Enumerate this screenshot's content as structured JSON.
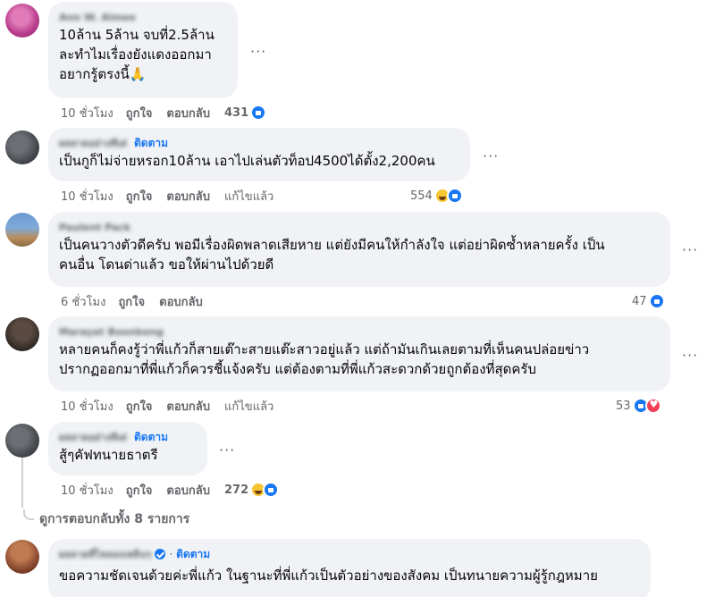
{
  "comments": [
    {
      "name": "Ann W. Aimee",
      "follow": "",
      "text": [
        "10ล้าน 5ล้าน จบที่2.5ล้าน",
        "ละทำไมเรื่องยังแดงออกมา",
        "อยากรู้ตรงนี้🙏"
      ],
      "time": "10 ชั่วโมง",
      "like": "ถูกใจ",
      "reply": "ตอบกลับ",
      "edited": "",
      "count": "431",
      "reactions": [
        "like"
      ]
    },
    {
      "name": "ผลลาดอย่างทีเด่",
      "follow": "ติดตาม",
      "text": [
        "เป็นกูก็ไม่จ่ายหรอก10ล้าน เอาไปเล่นตัวท็อป4500ได้ตั้ง2,200คน"
      ],
      "time": "10 ชั่วโมง",
      "like": "ถูกใจ",
      "reply": "ตอบกลับ",
      "edited": "แก้ไขแล้ว",
      "count": "554",
      "reactions": [
        "haha",
        "like"
      ]
    },
    {
      "name": "Paulent Pack",
      "follow": "",
      "text": [
        "เป็นคนวางตัวดีครับ พอมีเรื่องผิดพลาดเสียหาย แต่ยังมีคนให้กำลังใจ แต่อย่าผิดซ้ำหลายครั้ง เป็น",
        "คนอื่น โดนด่าแล้ว ขอให้ผ่านไปด้วยดี"
      ],
      "time": "6 ชั่วโมง",
      "like": "ถูกใจ",
      "reply": "ตอบกลับ",
      "edited": "",
      "count": "47",
      "reactions": [
        "like"
      ]
    },
    {
      "name": "Marayat Boonbong",
      "follow": "",
      "text": [
        "หลายคนก็คงรู้ว่าพี่แก้วก็สายเต๊าะสายแต๊ะสาวอยู่แล้ว แต่ถ้ามันเกินเลยตามที่เห็นคนปล่อยข่าว",
        "ปรากฏออกมาที่พี่แก้วก็ควรชี้แจ้งครับ แต่ต้องตามที่พี่แก้วสะดวกด้วยถูกต้องที่สุดครับ"
      ],
      "time": "10 ชั่วโมง",
      "like": "ถูกใจ",
      "reply": "ตอบกลับ",
      "edited": "แก้ไขแล้ว",
      "count": "53",
      "reactions": [
        "like",
        "love"
      ]
    },
    {
      "name": "ผลลาดอย่างทีเด่",
      "follow": "ติดตาม",
      "text": [
        "สู้ๆคัฟทนายธาตรี"
      ],
      "time": "10 ชั่วโมง",
      "like": "ถูกใจ",
      "reply": "ตอบกลับ",
      "edited": "",
      "count": "272",
      "reactions": [
        "haha",
        "like"
      ]
    }
  ],
  "view_replies": "ดูการตอบกลับทั้ง 8 รายการ",
  "last_comment": {
    "name": "ผลลาดที่ไหลลงเพลินๆ",
    "separator": "·",
    "follow": "ติดตาม",
    "text": "ขอความชัดเจนด้วยค่ะพี่แก้ว ในฐานะที่พี่แก้วเป็นตัวอย่างของสังคม เป็นทนายความผู้รู้กฎหมาย"
  },
  "more_label": "···"
}
